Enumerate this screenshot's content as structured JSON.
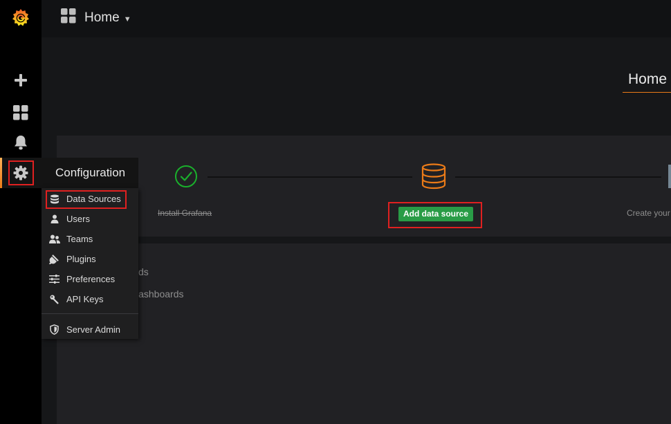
{
  "header": {
    "title": "Home"
  },
  "page": {
    "title": "Home"
  },
  "sidebar": {
    "items": [
      {
        "name": "grafana-logo"
      },
      {
        "name": "create",
        "icon": "plus-icon"
      },
      {
        "name": "dashboards",
        "icon": "dashboards-grid-icon"
      },
      {
        "name": "alerting",
        "icon": "bell-icon"
      },
      {
        "name": "configuration",
        "icon": "gear-icon",
        "active": true
      }
    ]
  },
  "config_menu": {
    "title": "Configuration",
    "items": [
      {
        "label": "Data Sources",
        "icon": "database-icon"
      },
      {
        "label": "Users",
        "icon": "user-icon"
      },
      {
        "label": "Teams",
        "icon": "users-icon"
      },
      {
        "label": "Plugins",
        "icon": "plug-icon"
      },
      {
        "label": "Preferences",
        "icon": "sliders-icon"
      },
      {
        "label": "API Keys",
        "icon": "key-icon"
      },
      {
        "label": "Server Admin",
        "icon": "shield-icon"
      }
    ]
  },
  "steps": {
    "install": {
      "label": "Install Grafana",
      "done": true
    },
    "datasource": {
      "button": "Add data source"
    },
    "create": {
      "label": "Create your"
    }
  },
  "dashboards_panel": {
    "line1": "ds",
    "line2": "lashboards"
  },
  "colors": {
    "accent_orange": "#eb7b18",
    "success_green": "#299c46",
    "check_green": "#1ab02c",
    "highlight_red": "#e02020"
  }
}
